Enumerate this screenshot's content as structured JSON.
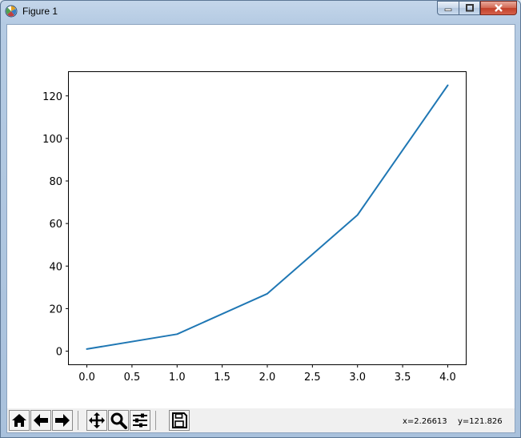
{
  "window": {
    "title": "Figure 1"
  },
  "toolbar": {
    "buttons": [
      "home-icon",
      "back-arrow-icon",
      "forward-arrow-icon",
      "pan-icon",
      "zoom-icon",
      "configure-subplots-icon",
      "save-icon"
    ],
    "coord_x": "x=2.26613",
    "coord_y": "y=121.826"
  },
  "colors": {
    "line": "#1f77b4"
  },
  "chart_data": {
    "type": "line",
    "x": [
      0,
      1,
      2,
      3,
      4
    ],
    "series": [
      {
        "values": [
          1,
          8,
          27,
          64,
          125
        ]
      }
    ],
    "xlim": [
      -0.2,
      4.2
    ],
    "ylim": [
      -6.2,
      131.2
    ],
    "xticks": [
      "0.0",
      "0.5",
      "1.0",
      "1.5",
      "2.0",
      "2.5",
      "3.0",
      "3.5",
      "4.0"
    ],
    "yticks": [
      "0",
      "20",
      "40",
      "60",
      "80",
      "100",
      "120"
    ],
    "grid": false
  }
}
